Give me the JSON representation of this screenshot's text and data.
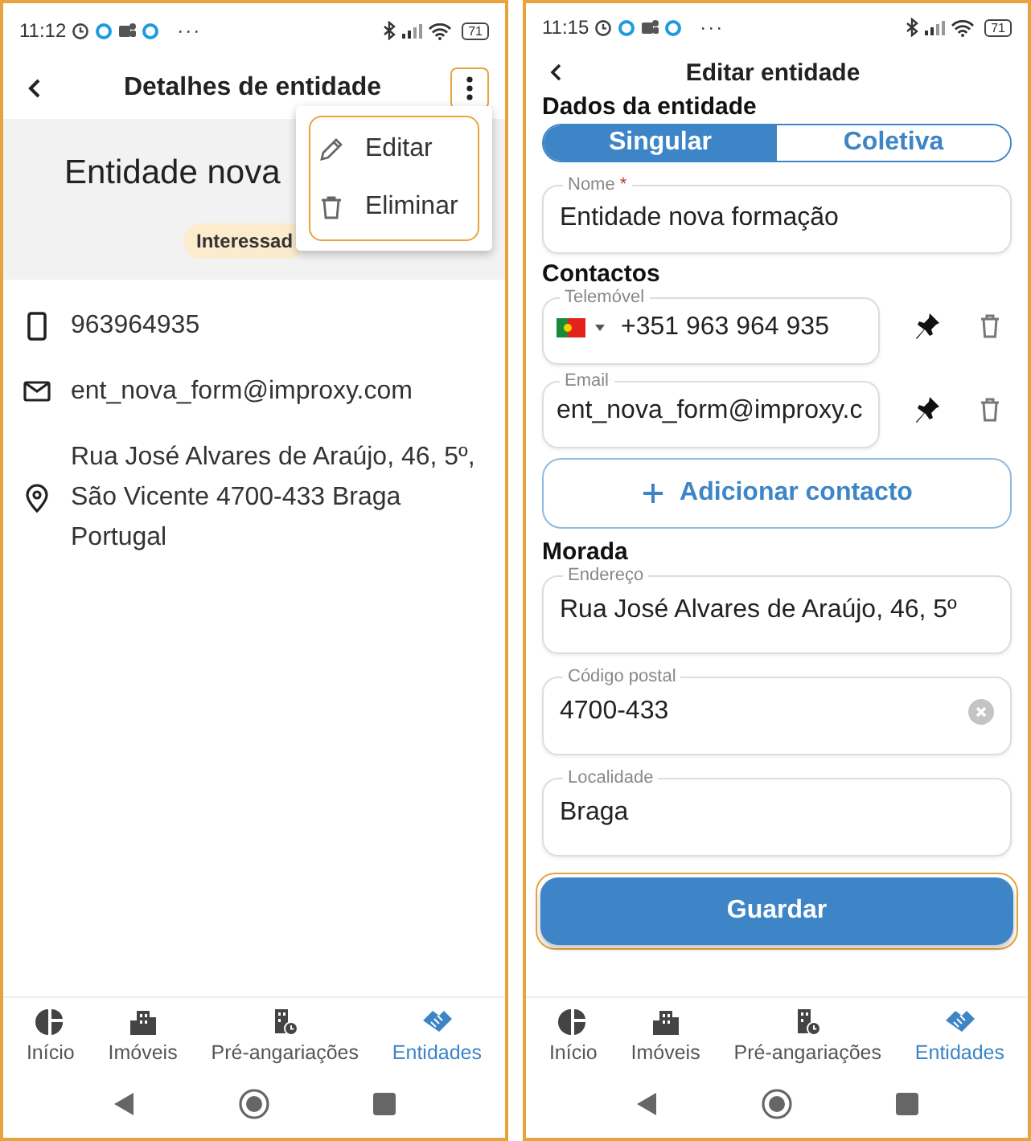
{
  "details_screen": {
    "status_bar": {
      "time": "11:12",
      "more": "···",
      "battery": "71"
    },
    "header": {
      "title": "Detalhes de entidade",
      "menu_highlighted": true
    },
    "hero": {
      "name": "Entidade nova",
      "chip": "Interessad"
    },
    "menu": {
      "highlighted": true,
      "items": [
        {
          "kind": "edit",
          "label": "Editar"
        },
        {
          "kind": "delete",
          "label": "Eliminar"
        }
      ]
    },
    "contacts": [
      {
        "kind": "phone",
        "text": "963964935"
      },
      {
        "kind": "email",
        "text": "ent_nova_form@improxy.com"
      },
      {
        "kind": "address",
        "text": "Rua José Alvares de Araújo, 46, 5º, São Vicente 4700-433 Braga Portugal"
      }
    ],
    "bottom_nav": [
      {
        "kind": "home",
        "label": "Início",
        "selected": false
      },
      {
        "kind": "buildings",
        "label": "Imóveis",
        "selected": false
      },
      {
        "kind": "pre",
        "label": "Pré-angariações",
        "selected": false
      },
      {
        "kind": "entities",
        "label": "Entidades",
        "selected": true
      }
    ]
  },
  "edit_screen": {
    "status_bar": {
      "time": "11:15",
      "more": "···",
      "battery": "71"
    },
    "header": {
      "title": "Editar entidade"
    },
    "section_data": "Dados da entidade",
    "type_toggle": [
      {
        "label": "Singular",
        "selected": true
      },
      {
        "label": "Coletiva",
        "selected": false
      }
    ],
    "name_field": {
      "label": "Nome",
      "required_mark": "*",
      "value": "Entidade nova formação"
    },
    "section_contacts": "Contactos",
    "contacts": [
      {
        "kind": "phone",
        "label": "Telemóvel",
        "value": "+351 963 964 935"
      },
      {
        "kind": "email",
        "label": "Email",
        "value": "ent_nova_form@improxy.c"
      }
    ],
    "add_contact": "Adicionar contacto",
    "section_address": "Morada",
    "address_fields": [
      {
        "label": "Endereço",
        "value": "Rua José Alvares de Araújo, 46, 5º",
        "clearable": false
      },
      {
        "label": "Código postal",
        "value": "4700-433",
        "clearable": true
      },
      {
        "label": "Localidade",
        "value": "Braga",
        "clearable": false
      }
    ],
    "save": {
      "label": "Guardar",
      "highlighted": true
    },
    "bottom_nav": [
      {
        "kind": "home",
        "label": "Início",
        "selected": false
      },
      {
        "kind": "buildings",
        "label": "Imóveis",
        "selected": false
      },
      {
        "kind": "pre",
        "label": "Pré-angariações",
        "selected": false
      },
      {
        "kind": "entities",
        "label": "Entidades",
        "selected": true
      }
    ]
  }
}
